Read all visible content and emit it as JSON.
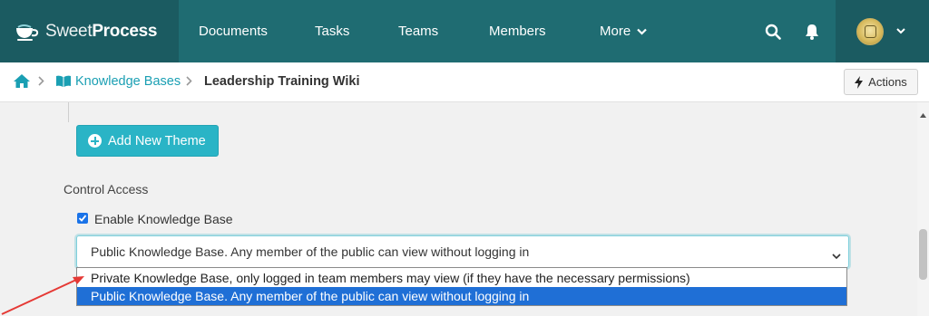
{
  "brand": {
    "light": "Sweet",
    "bold": "Process"
  },
  "nav": {
    "items": [
      "Documents",
      "Tasks",
      "Teams",
      "Members"
    ],
    "more_label": "More"
  },
  "breadcrumb": {
    "kb_label": "Knowledge Bases",
    "current": "Leadership Training Wiki"
  },
  "toolbar": {
    "actions_label": "Actions"
  },
  "form": {
    "add_theme_label": "Add New Theme",
    "control_access_label": "Control Access",
    "enable_kb_label": "Enable Knowledge Base",
    "enable_kb_checked": true,
    "visibility_selected": "Public Knowledge Base. Any member of the public can view without logging in",
    "visibility_options": [
      "Private Knowledge Base, only logged in team members may view (if they have the necessary permissions)",
      "Public Knowledge Base. Any member of the public can view without logging in"
    ]
  },
  "colors": {
    "nav_bg": "#1f6c72",
    "nav_dark": "#1b5b61",
    "accent": "#2ab4c6",
    "link": "#1a9fb3",
    "selected_option": "#1f6fd6",
    "annotation_arrow": "#e53935"
  },
  "icons": [
    "teacup-logo-icon",
    "chevron-down-icon",
    "search-icon",
    "bell-icon",
    "home-icon",
    "book-icon",
    "chevron-right-icon",
    "bolt-icon",
    "plus-circle-icon",
    "checkbox-icon"
  ]
}
